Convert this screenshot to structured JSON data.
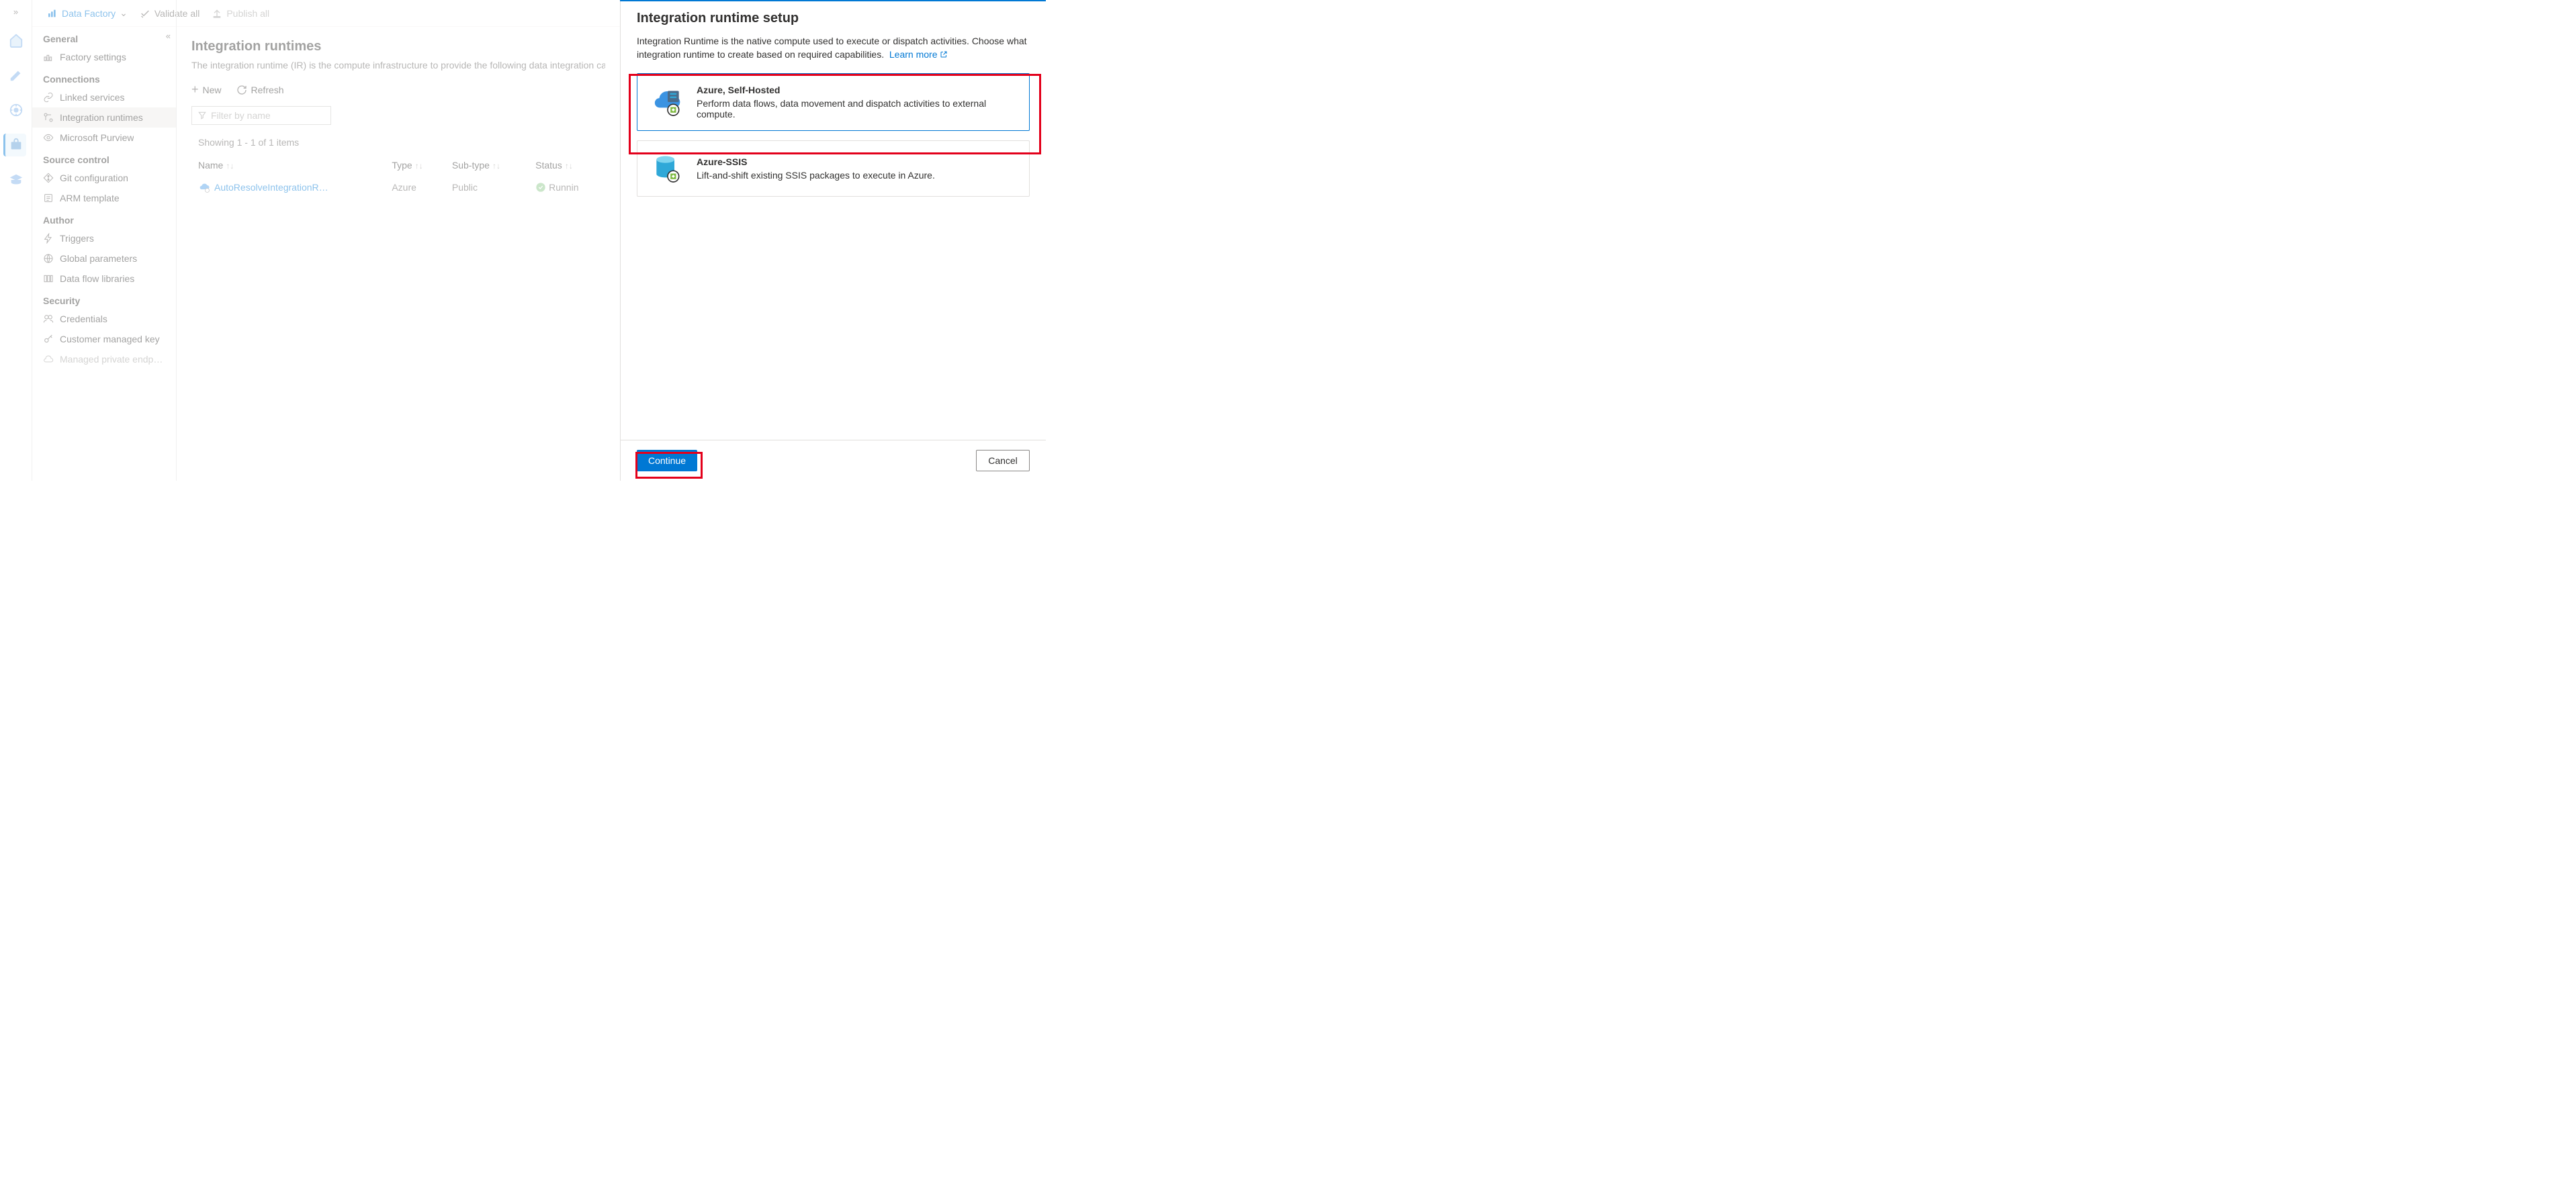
{
  "toolbar": {
    "brand": "Data Factory",
    "validate": "Validate all",
    "publish": "Publish all"
  },
  "sidebar": {
    "sections": {
      "general": "General",
      "connections": "Connections",
      "source": "Source control",
      "author": "Author",
      "security": "Security"
    },
    "items": {
      "factory_settings": "Factory settings",
      "linked_services": "Linked services",
      "integration_runtimes": "Integration runtimes",
      "purview": "Microsoft Purview",
      "git": "Git configuration",
      "arm": "ARM template",
      "triggers": "Triggers",
      "global_params": "Global parameters",
      "dataflow_libs": "Data flow libraries",
      "credentials": "Credentials",
      "cmkey": "Customer managed key",
      "mpe": "Managed private endpoints"
    }
  },
  "main": {
    "title": "Integration runtimes",
    "desc": "The integration runtime (IR) is the compute infrastructure to provide the following data integration capabilities",
    "new": "New",
    "refresh": "Refresh",
    "filter_ph": "Filter by name",
    "count": "Showing 1 - 1 of 1 items",
    "cols": {
      "name": "Name",
      "type": "Type",
      "subtype": "Sub-type",
      "status": "Status"
    },
    "row": {
      "name": "AutoResolveIntegrationR…",
      "type": "Azure",
      "subtype": "Public",
      "status": "Runnin"
    }
  },
  "panel": {
    "title": "Integration runtime setup",
    "desc": "Integration Runtime is the native compute used to execute or dispatch activities. Choose what integration runtime to create based on required capabilities.",
    "learn_more": "Learn more",
    "opt1": {
      "title": "Azure, Self-Hosted",
      "sub": "Perform data flows, data movement and dispatch activities to external compute."
    },
    "opt2": {
      "title": "Azure-SSIS",
      "sub": "Lift-and-shift existing SSIS packages to execute in Azure."
    },
    "continue": "Continue",
    "cancel": "Cancel"
  }
}
